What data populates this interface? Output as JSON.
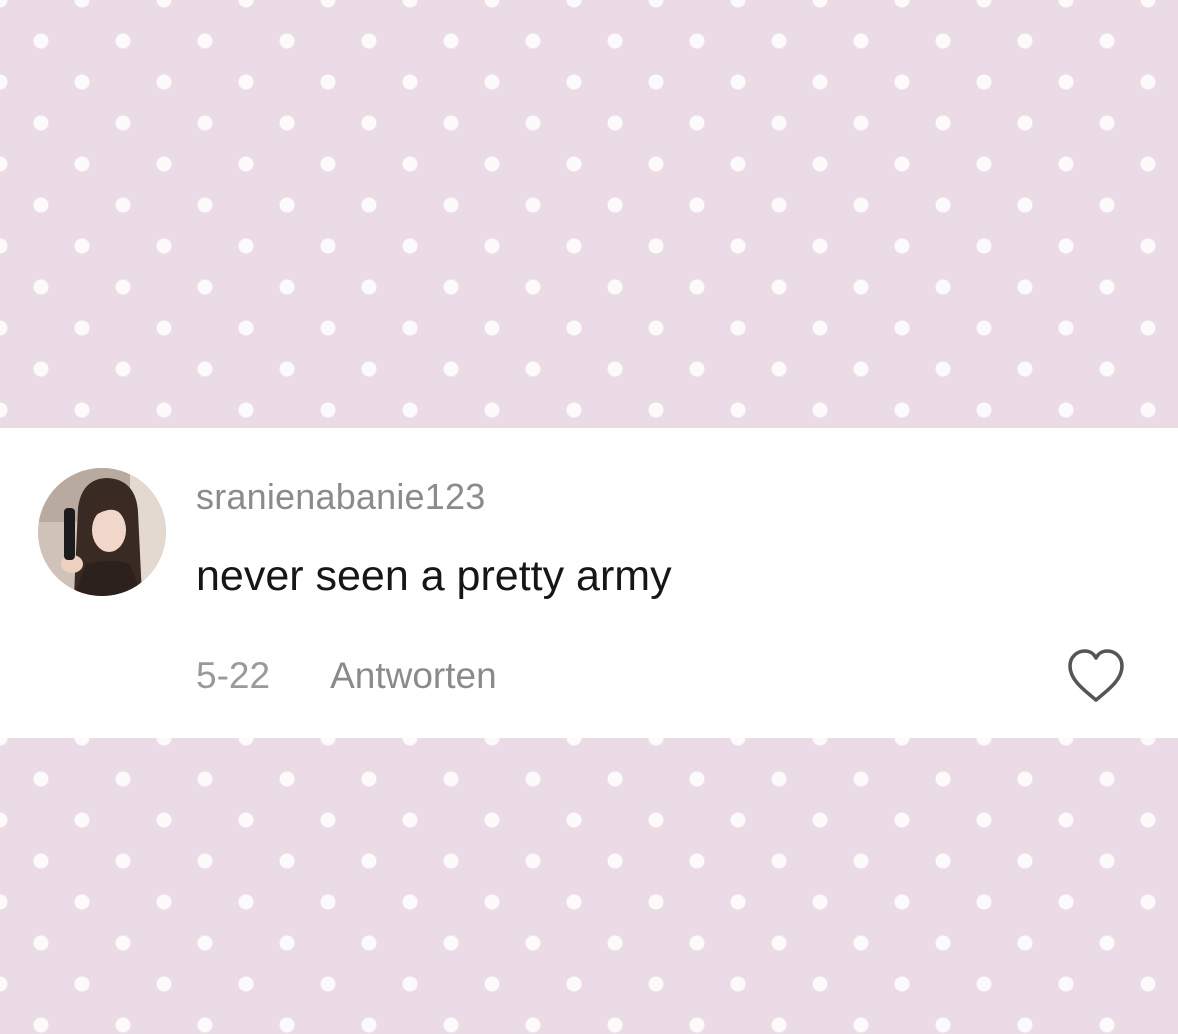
{
  "comment": {
    "avatar_icon": "profile-photo-avatar",
    "username": "sranienabanie123",
    "text": "never seen a pretty army",
    "date": "5-22",
    "reply_label": "Antworten",
    "like_icon": "heart-outline-icon"
  },
  "colors": {
    "background": "#eadbe6",
    "polka_dot": "#ffffff",
    "card": "#ffffff",
    "username": "#8b8b8b",
    "comment_text": "#161616",
    "meta_text": "#9a9a9a",
    "heart_outline": "#555555"
  }
}
